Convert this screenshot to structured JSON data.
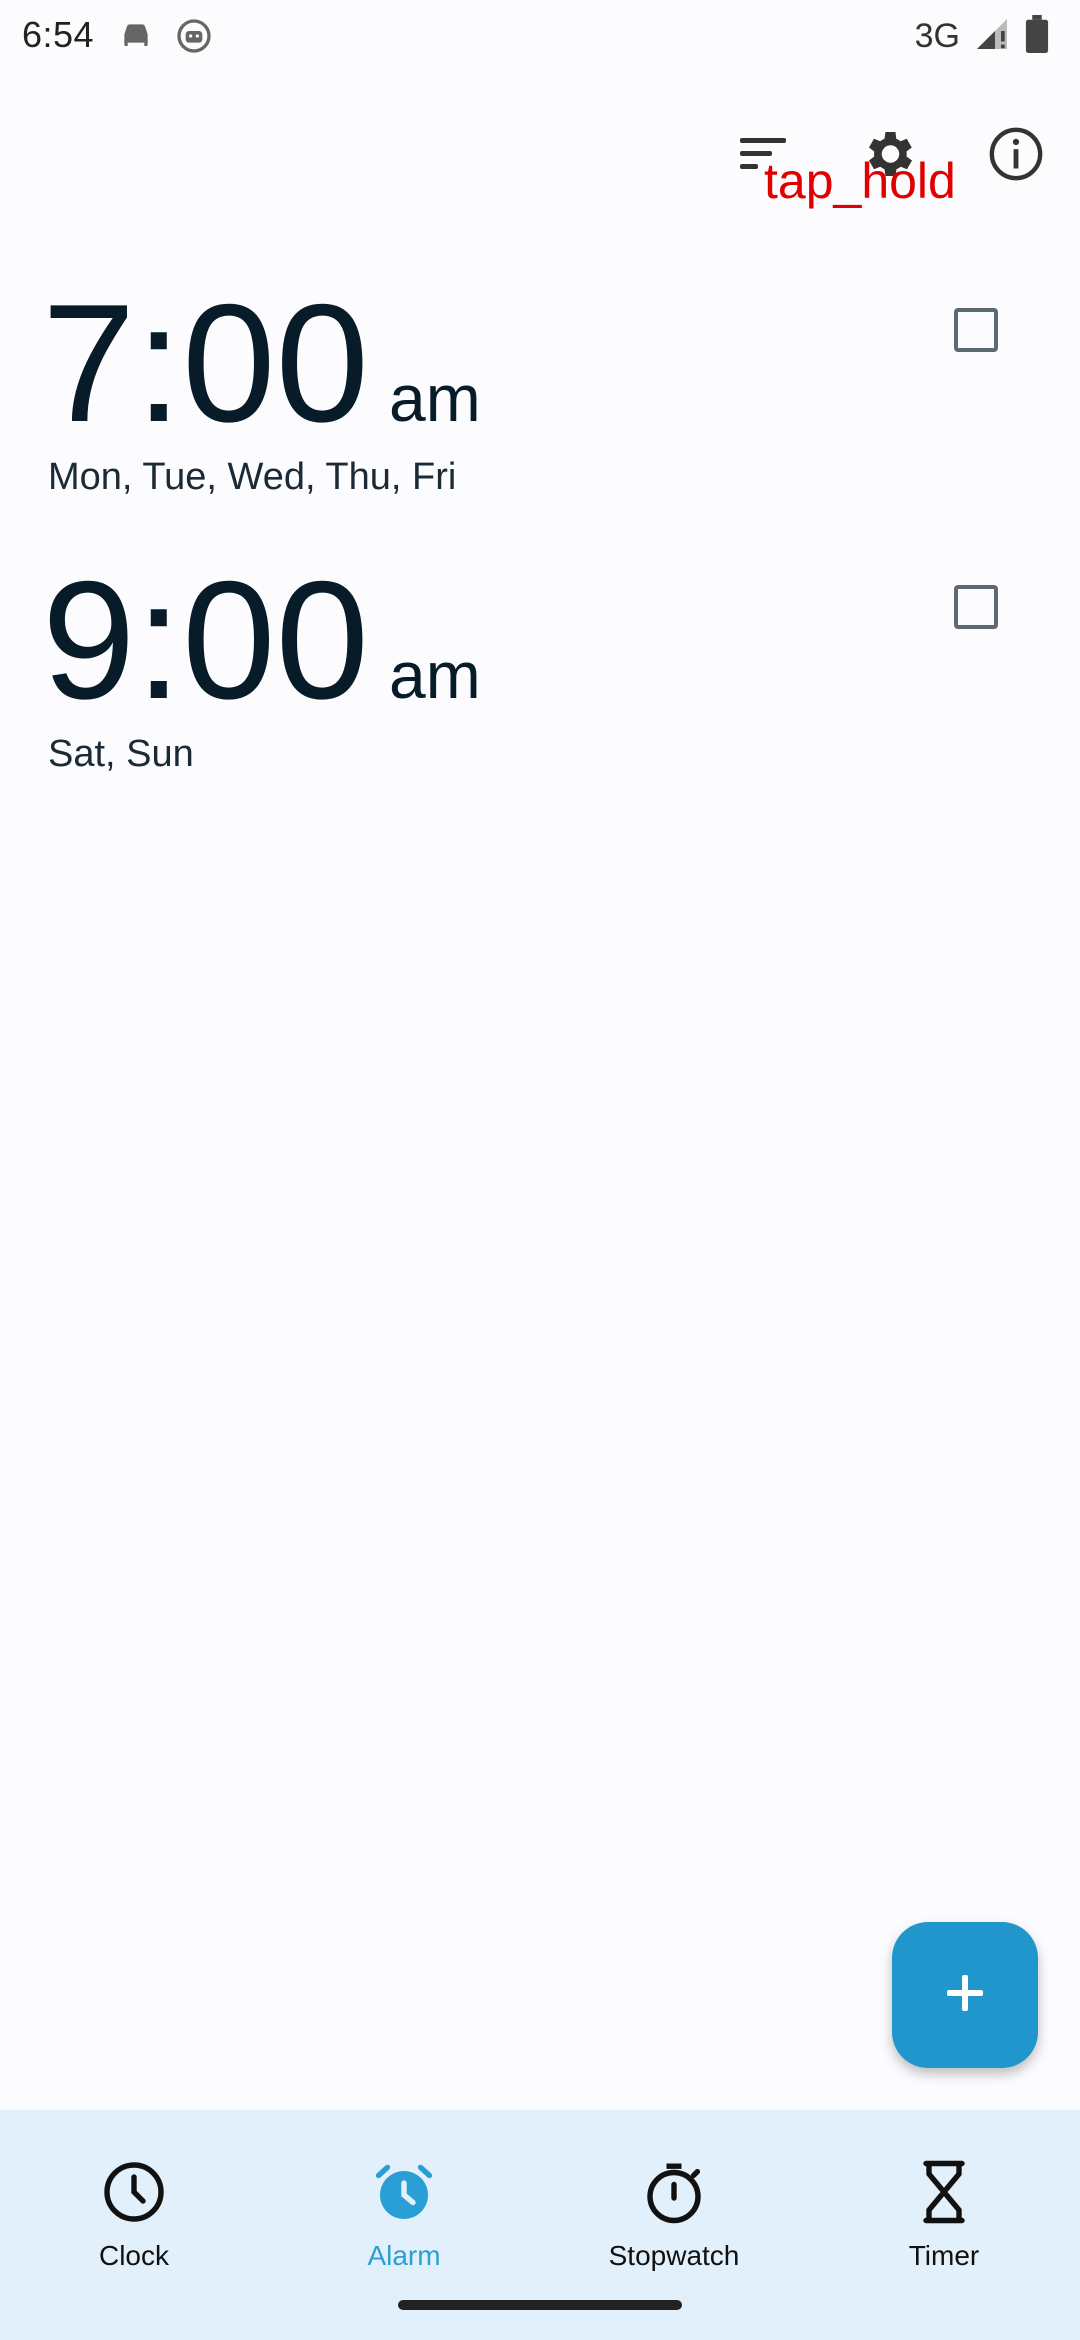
{
  "status_bar": {
    "time": "6:54",
    "network": "3G"
  },
  "overlay": {
    "label": "tap_hold"
  },
  "alarms": [
    {
      "time": "7:00",
      "period": "am",
      "days": "Mon, Tue, Wed, Thu, Fri"
    },
    {
      "time": "9:00",
      "period": "am",
      "days": "Sat, Sun"
    }
  ],
  "nav": {
    "items": [
      {
        "label": "Clock"
      },
      {
        "label": "Alarm"
      },
      {
        "label": "Stopwatch"
      },
      {
        "label": "Timer"
      }
    ],
    "active": "Alarm"
  },
  "colors": {
    "accent": "#2196cc",
    "active_nav": "#2a9fd6",
    "nav_bg": "#e1f0fb",
    "overlay_text": "#e00000",
    "background": "#fcfcff"
  }
}
